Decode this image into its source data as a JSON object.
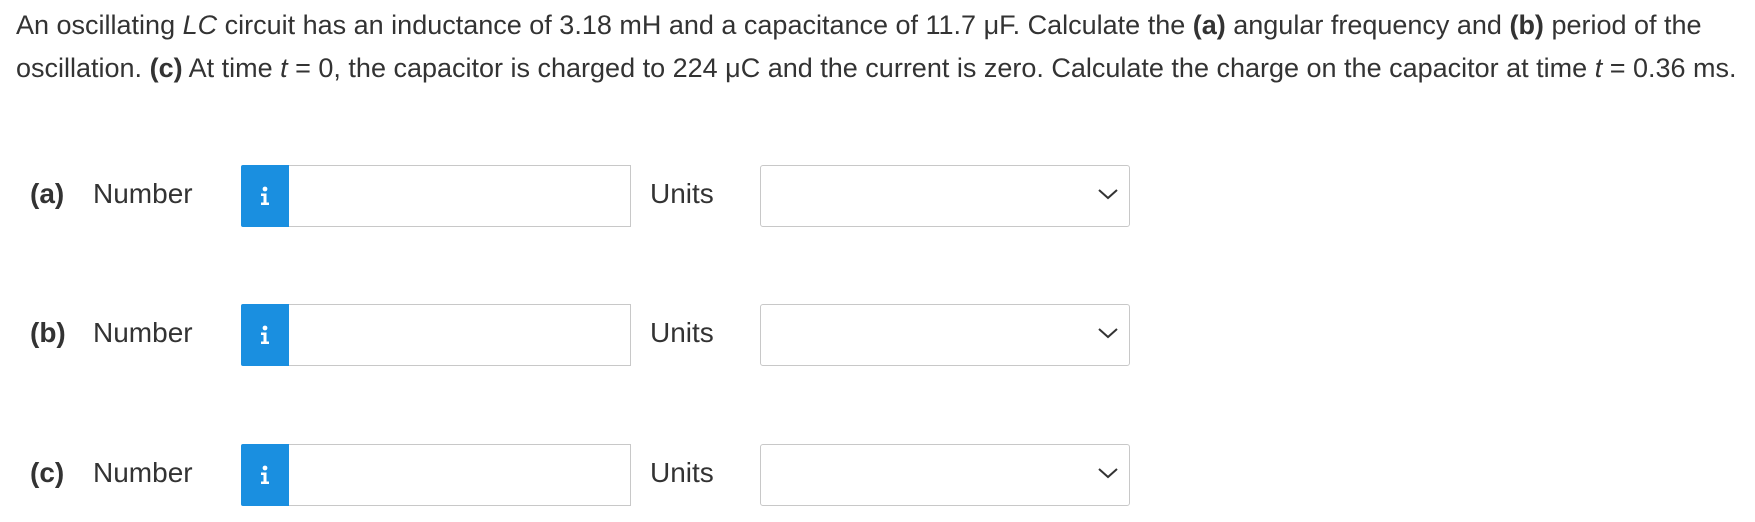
{
  "question": {
    "s1": "An oscillating ",
    "s2": "LC",
    "s3": " circuit has an inductance of 3.18 mH and a capacitance of 11.7 μF. Calculate the ",
    "s4": "(a)",
    "s5": " angular frequency and ",
    "s6": "(b)",
    "s7": " period of the oscillation. ",
    "s8": "(c)",
    "s9": " At time ",
    "s10": "t",
    "s11": " = 0, the capacitor is charged to 224 μC and the current is zero. Calculate the charge on the capacitor at time ",
    "s12": "t",
    "s13": " = 0.36 ms."
  },
  "parts": [
    {
      "label": "(a)",
      "number_label": "Number",
      "info_icon": "i",
      "number_value": "",
      "units_label": "Units",
      "units_value": ""
    },
    {
      "label": "(b)",
      "number_label": "Number",
      "info_icon": "i",
      "number_value": "",
      "units_label": "Units",
      "units_value": ""
    },
    {
      "label": "(c)",
      "number_label": "Number",
      "info_icon": "i",
      "number_value": "",
      "units_label": "Units",
      "units_value": ""
    }
  ],
  "colors": {
    "info_button": "#1a8fe0",
    "text": "#333333",
    "border": "#c8c8c8"
  },
  "icons": {
    "info": "info-icon",
    "dropdown": "chevron-down-icon"
  }
}
